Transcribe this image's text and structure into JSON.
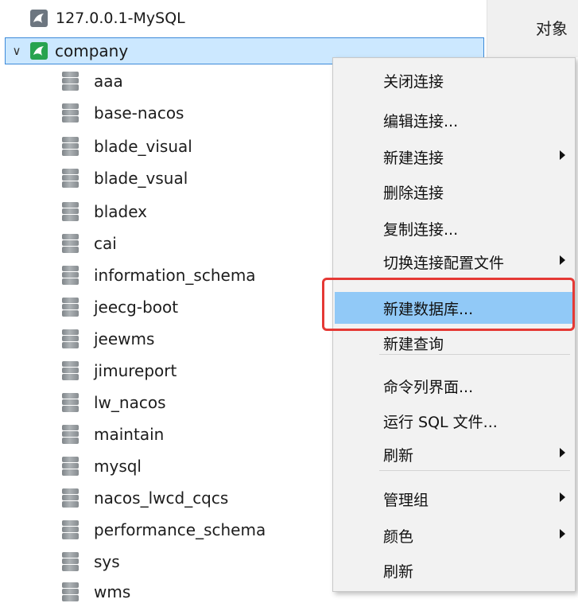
{
  "right_tab": {
    "label": "对象"
  },
  "tree": {
    "connections": [
      {
        "label": "127.0.0.1-MySQL",
        "icon": "mysql-connection-icon",
        "color": "#6d7680",
        "expanded": false
      },
      {
        "label": "company",
        "icon": "mysql-connection-icon",
        "color": "#27a34f",
        "expanded": true,
        "selected": true
      }
    ],
    "databases": [
      "aaa",
      "base-nacos",
      "blade_visual",
      "blade_vsual",
      "bladex",
      "cai",
      "information_schema",
      "jeecg-boot",
      "jeewms",
      "jimureport",
      "lw_nacos",
      "maintain",
      "mysql",
      "nacos_lwcd_cqcs",
      "performance_schema",
      "sys",
      "wms"
    ]
  },
  "context_menu": {
    "items": [
      {
        "label": "关闭连接",
        "submenu": false
      },
      {
        "label": "编辑连接...",
        "submenu": false
      },
      {
        "label": "新建连接",
        "submenu": true
      },
      {
        "label": "删除连接",
        "submenu": false
      },
      {
        "label": "复制连接...",
        "submenu": false
      },
      {
        "label": "切换连接配置文件",
        "submenu": true
      },
      {
        "label": "新建数据库...",
        "submenu": false,
        "highlighted": true
      },
      {
        "label": "新建查询",
        "submenu": false
      },
      {
        "label": "命令列界面...",
        "submenu": false
      },
      {
        "label": "运行 SQL 文件...",
        "submenu": false
      },
      {
        "label": "刷新",
        "submenu": true
      },
      {
        "label": "管理组",
        "submenu": true
      },
      {
        "label": "颜色",
        "submenu": true
      },
      {
        "label": "刷新",
        "submenu": false
      }
    ],
    "highlight_color": "#91c9f7",
    "annotation_color": "#e53935"
  }
}
